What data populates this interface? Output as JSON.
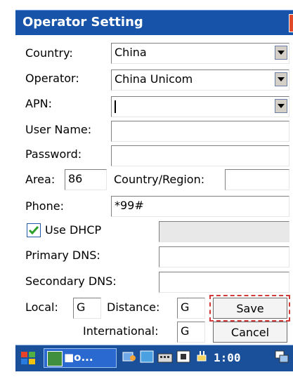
{
  "window": {
    "title": "Operator Setting"
  },
  "form": {
    "country_label": "Country:",
    "country_value": "China",
    "operator_label": "Operator:",
    "operator_value": "China Unicom",
    "apn_label": "APN:",
    "apn_value": "",
    "username_label": "User Name:",
    "username_value": "",
    "password_label": "Password:",
    "password_value": "",
    "area_label": "Area:",
    "area_value": "86",
    "country_region_label": "Country/Region:",
    "country_region_value": "",
    "phone_label": "Phone:",
    "phone_value": "*99#",
    "dhcp_label": "Use DHCP",
    "dhcp_checked": true,
    "dhcp_value": "",
    "primary_dns_label": "Primary DNS:",
    "primary_dns_value": "",
    "secondary_dns_label": "Secondary DNS:",
    "secondary_dns_value": "",
    "local_label": "Local:",
    "local_value": "G",
    "distance_label": "Distance:",
    "distance_value": "G",
    "international_label": "International:",
    "international_value": "G"
  },
  "buttons": {
    "save": "Save",
    "cancel": "Cancel"
  },
  "taskbar": {
    "app_label": "■o...",
    "time": "1:00"
  },
  "colors": {
    "titlebar": "#1753a8",
    "taskbar": "#1a4f9a",
    "close": "#e04a2a",
    "highlight": "#d23a3a"
  }
}
